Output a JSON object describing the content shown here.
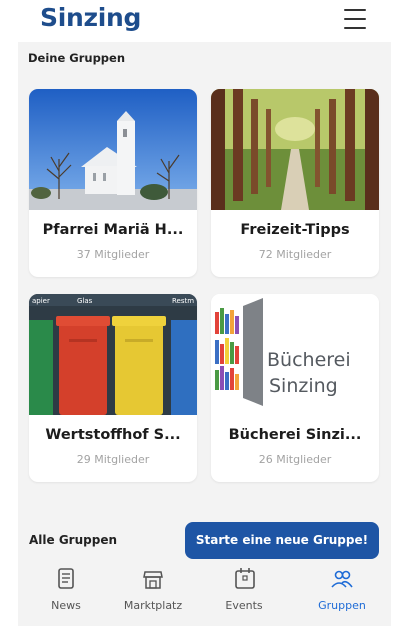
{
  "header": {
    "title": "Sinzing",
    "menu_icon": "hamburger-menu-icon"
  },
  "section": {
    "title": "Deine Gruppen"
  },
  "groups": [
    {
      "name": "Pfarrei Mariä H...",
      "members": "37 Mitglieder",
      "image": "church-photo"
    },
    {
      "name": "Freizeit-Tipps",
      "members": "72 Mitglieder",
      "image": "forest-path-photo"
    },
    {
      "name": "Wertstoffhof S...",
      "members": "29 Mitglieder",
      "image": "recycling-bins-photo",
      "image_labels": [
        "apier",
        "Glas",
        "Restm"
      ]
    },
    {
      "name": "Bücherei Sinzi...",
      "members": "26 Mitglieder",
      "image": "library-logo",
      "image_labels": [
        "Bücherei",
        "Sinzing"
      ]
    }
  ],
  "footer": {
    "all_groups": "Alle Gruppen",
    "new_group_button": "Starte eine neue Gruppe!"
  },
  "nav": [
    {
      "label": "News",
      "icon": "newspaper-icon",
      "active": false
    },
    {
      "label": "Marktplatz",
      "icon": "storefront-icon",
      "active": false
    },
    {
      "label": "Events",
      "icon": "calendar-icon",
      "active": false
    },
    {
      "label": "Gruppen",
      "icon": "people-icon",
      "active": true
    }
  ],
  "colors": {
    "brand": "#1e4d8c",
    "button": "#1e55a5",
    "active_nav": "#1e6bd6",
    "background": "#f3f3f3"
  }
}
